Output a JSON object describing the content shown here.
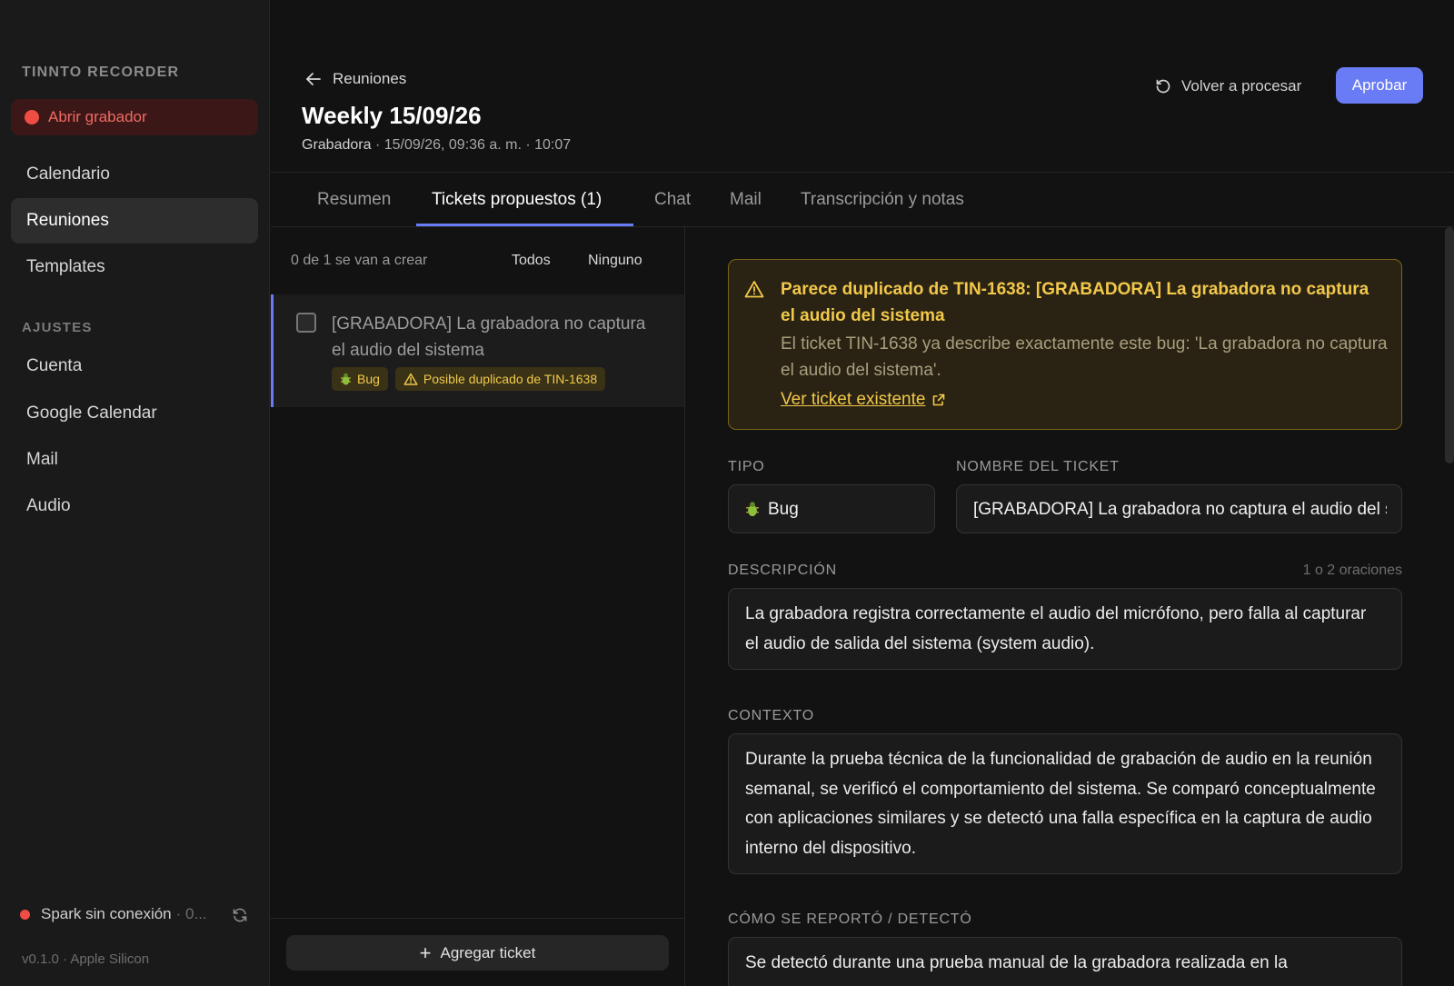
{
  "sidebar": {
    "brand": "TINNTO RECORDER",
    "record_button": "Abrir grabador",
    "nav": [
      {
        "label": "Calendario"
      },
      {
        "label": "Reuniones"
      },
      {
        "label": "Templates"
      }
    ],
    "settings_label": "AJUSTES",
    "settings": [
      {
        "label": "Cuenta"
      },
      {
        "label": "Google Calendar"
      },
      {
        "label": "Mail"
      },
      {
        "label": "Audio"
      }
    ],
    "status": "Spark sin conexión",
    "status_sub": "· 0...",
    "version": "v0.1.0 · Apple Silicon",
    "colors": {
      "record": "#ef4d44",
      "active_bg": "#2d2d2d"
    }
  },
  "header": {
    "back_label": "Reuniones",
    "title": "Weekly 15/09/26",
    "source": "Grabadora",
    "meta": " · 15/09/26, 09:36 a. m. · 10:07",
    "reprocess_label": "Volver a procesar",
    "approve_label": "Aprobar",
    "accent": "#6a7cf5"
  },
  "tabs": [
    {
      "label": "Resumen"
    },
    {
      "label": "Tickets propuestos (1)"
    },
    {
      "label": "Chat"
    },
    {
      "label": "Mail"
    },
    {
      "label": "Transcripción y notas"
    }
  ],
  "ticket_list": {
    "count_text": "0 de 1 se van a crear",
    "all_label": "Todos",
    "none_label": "Ninguno",
    "items": [
      {
        "title": "[GRABADORA] La grabadora no captura el audio del sistema",
        "checked": false,
        "type_badge": "Bug",
        "dup_badge": "Posible duplicado de TIN-1638"
      }
    ],
    "add_label": "Agregar ticket"
  },
  "detail": {
    "warning": {
      "title": "Parece duplicado de TIN-1638: [GRABADORA] La grabadora no captura el audio del sistema",
      "body": "El ticket TIN-1638 ya describe exactamente este bug: 'La grabadora no captura el audio del sistema'.",
      "link": "Ver ticket existente",
      "color": "#f2c84b"
    },
    "type_label": "TIPO",
    "type_value": "Bug",
    "name_label": "NOMBRE DEL TICKET",
    "name_value": "[GRABADORA] La grabadora no captura el audio del sistema",
    "description_label": "DESCRIPCIÓN",
    "description_hint": "1 o 2 oraciones",
    "description_value": "La grabadora registra correctamente el audio del micrófono, pero falla al capturar el audio de salida del sistema (system audio).",
    "context_label": "CONTEXTO",
    "context_value": "Durante la prueba técnica de la funcionalidad de grabación de audio en la reunión semanal, se verificó el comportamiento del sistema. Se comparó conceptualmente con aplicaciones similares y se detectó una falla específica en la captura de audio interno del dispositivo.",
    "reported_label": "CÓMO SE REPORTÓ / DETECTÓ",
    "reported_value": "Se detectó durante una prueba manual de la grabadora realizada en la"
  }
}
